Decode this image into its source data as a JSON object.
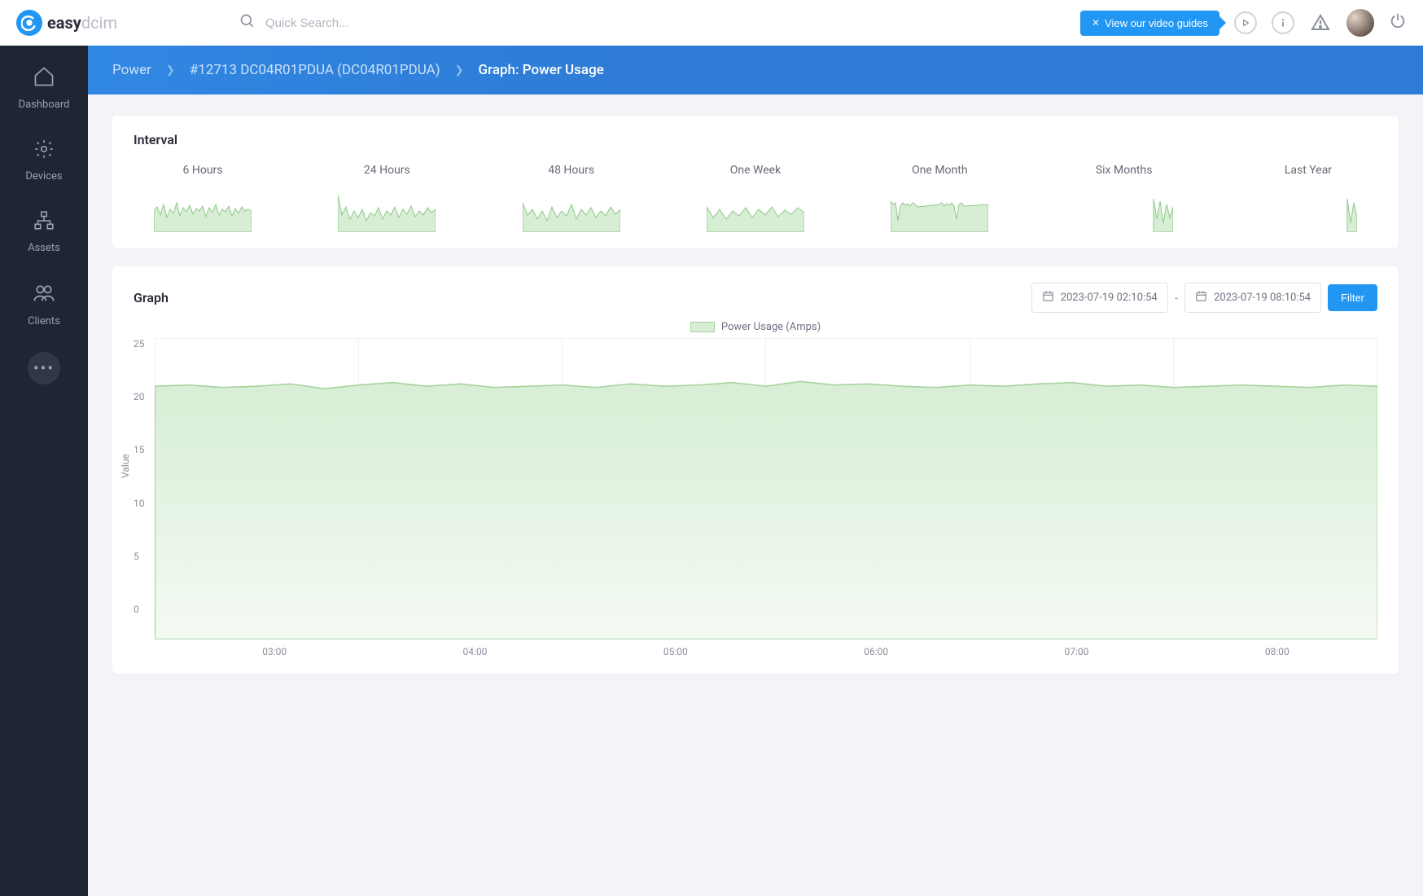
{
  "logo": {
    "text_dark": "easy",
    "text_light": "dcim"
  },
  "topbar": {
    "search_placeholder": "Quick Search...",
    "video_guide_label": "View our video guides"
  },
  "sidebar": {
    "items": [
      {
        "label": "Dashboard",
        "icon": "home"
      },
      {
        "label": "Devices",
        "icon": "gear"
      },
      {
        "label": "Assets",
        "icon": "network"
      },
      {
        "label": "Clients",
        "icon": "users"
      }
    ]
  },
  "breadcrumb": {
    "items": [
      {
        "label": "Power"
      },
      {
        "label": "#12713 DC04R01PDUA (DC04R01PDUA)"
      }
    ],
    "current": "Graph: Power Usage"
  },
  "interval_panel": {
    "title": "Interval",
    "options": [
      {
        "label": "6 Hours"
      },
      {
        "label": "24 Hours"
      },
      {
        "label": "48 Hours"
      },
      {
        "label": "One Week"
      },
      {
        "label": "One Month"
      },
      {
        "label": "Six Months"
      },
      {
        "label": "Last Year"
      }
    ]
  },
  "graph_panel": {
    "title": "Graph",
    "date_from": "2023-07-19 02:10:54",
    "date_to": "2023-07-19 08:10:54",
    "filter_label": "Filter",
    "legend_label": "Power Usage (Amps)",
    "y_label": "Value",
    "y_ticks": [
      "25",
      "20",
      "15",
      "10",
      "5",
      "0"
    ],
    "x_ticks": [
      "03:00",
      "04:00",
      "05:00",
      "06:00",
      "07:00",
      "08:00"
    ]
  },
  "chart_data": {
    "type": "area",
    "title": "Power Usage (Amps)",
    "xlabel": "",
    "ylabel": "Value",
    "ylim": [
      0,
      25
    ],
    "x": [
      "02:11",
      "02:20",
      "02:30",
      "02:40",
      "02:50",
      "03:00",
      "03:10",
      "03:20",
      "03:30",
      "03:40",
      "03:50",
      "04:00",
      "04:10",
      "04:20",
      "04:30",
      "04:40",
      "04:50",
      "05:00",
      "05:10",
      "05:20",
      "05:30",
      "05:40",
      "05:50",
      "06:00",
      "06:10",
      "06:20",
      "06:30",
      "06:40",
      "06:50",
      "07:00",
      "07:10",
      "07:20",
      "07:30",
      "07:40",
      "07:50",
      "08:00",
      "08:10"
    ],
    "series": [
      {
        "name": "Power Usage (Amps)",
        "values": [
          21.0,
          21.1,
          20.9,
          21.0,
          21.2,
          20.8,
          21.1,
          21.3,
          21.0,
          21.2,
          20.9,
          21.0,
          21.1,
          20.9,
          21.2,
          21.0,
          21.1,
          21.3,
          21.0,
          21.4,
          21.1,
          21.2,
          21.0,
          20.9,
          21.1,
          21.0,
          21.2,
          21.3,
          21.0,
          21.1,
          20.9,
          21.0,
          21.1,
          21.0,
          20.9,
          21.1,
          21.0
        ]
      }
    ]
  }
}
